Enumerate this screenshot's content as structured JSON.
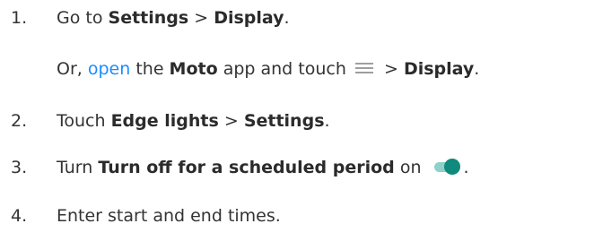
{
  "steps": [
    {
      "number": "1.",
      "pre": "Go to ",
      "settings": "Settings",
      "sep": " > ",
      "display": "Display",
      "end": "."
    },
    {
      "or": "Or, ",
      "open_link": "open",
      "the": " the ",
      "moto": "Moto",
      "app_touch": " app and touch ",
      "sep": " > ",
      "display": "Display",
      "end": ".",
      "icon": "menu-icon"
    },
    {
      "number": "2.",
      "pre": "Touch ",
      "edge_lights": "Edge lights",
      "sep": " > ",
      "settings": "Settings",
      "end": "."
    },
    {
      "number": "3.",
      "pre": "Turn ",
      "option": "Turn off for a scheduled period",
      "on": " on ",
      "end": ".",
      "icon": "toggle-on-icon",
      "toggle_state": "on"
    },
    {
      "number": "4.",
      "text": "Enter start and end times."
    }
  ],
  "colors": {
    "text": "#333333",
    "link": "#1a8cff",
    "toggle_track": "#8fd0cb",
    "toggle_knob": "#0f8a7c",
    "menu_icon": "#9e9e9e"
  }
}
